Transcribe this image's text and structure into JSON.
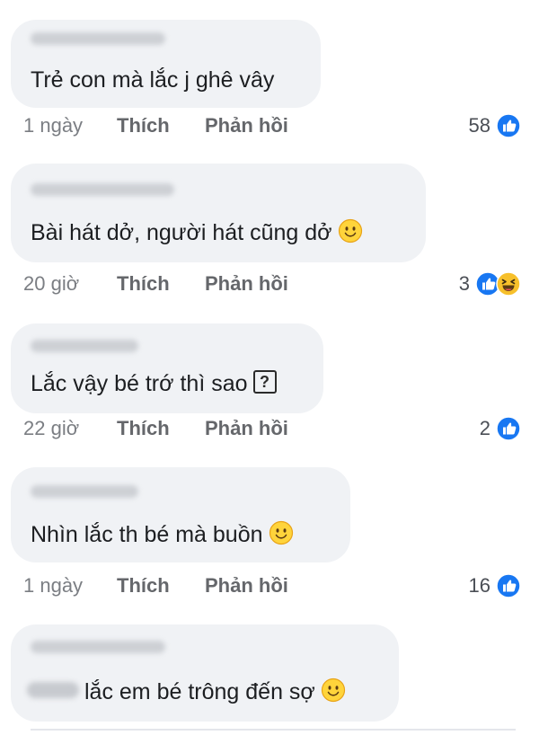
{
  "actions": {
    "like_label": "Thích",
    "reply_label": "Phản hồi"
  },
  "comments": [
    {
      "text": "Trẻ con mà lắc j ghê vây",
      "time": "1 ngày",
      "reaction_count": "58",
      "reactions": [
        "like-icon"
      ],
      "trailing": "none"
    },
    {
      "text": "Bài hát dở, người hát cũng dở",
      "time": "20 giờ",
      "reaction_count": "3",
      "reactions": [
        "like-icon",
        "haha-icon"
      ],
      "trailing": "slightly-smiling-face-emoji"
    },
    {
      "text": "Lắc vậy bé trớ thì sao",
      "time": "22 giờ",
      "reaction_count": "2",
      "reactions": [
        "like-icon"
      ],
      "trailing": "question-mark-box-emoji"
    },
    {
      "text": "Nhìn lắc th bé mà buồn",
      "time": "1 ngày",
      "reaction_count": "16",
      "reactions": [
        "like-icon"
      ],
      "trailing": "slightly-smiling-face-emoji"
    },
    {
      "text": "lắc em bé trông đến sợ",
      "time": "",
      "reaction_count": "",
      "reactions": [],
      "trailing": "slightly-smiling-face-emoji"
    }
  ],
  "colors": {
    "bubble": "#f0f2f5",
    "like_blue": "#1877f2",
    "haha_yellow": "#f7c02b",
    "meta_gray": "#65676b"
  }
}
